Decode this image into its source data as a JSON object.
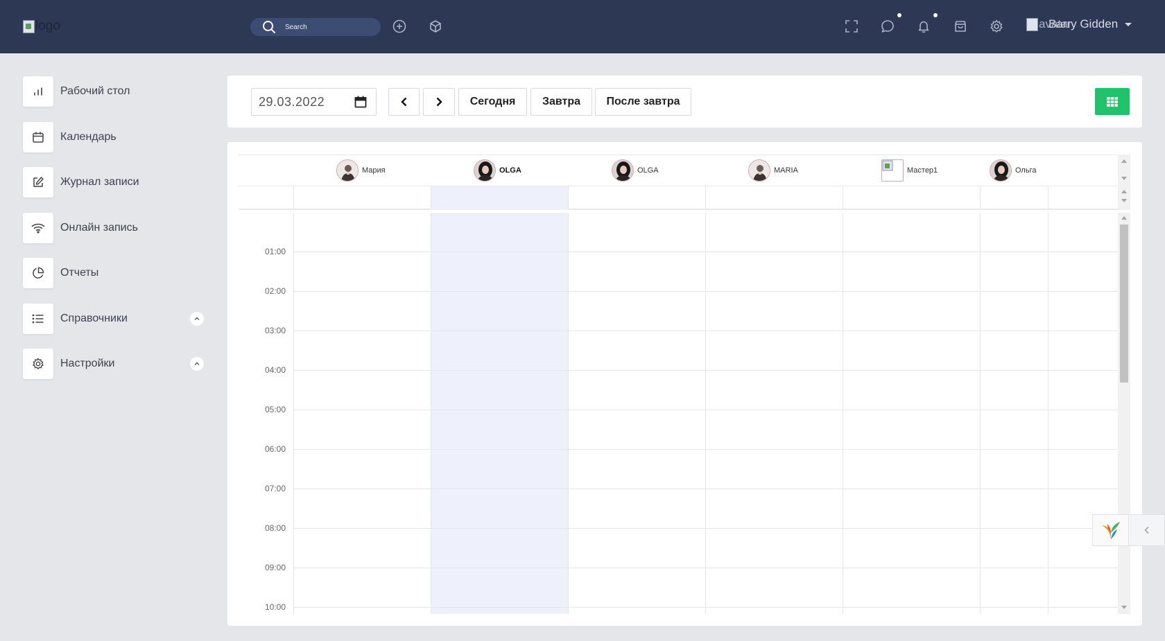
{
  "header": {
    "logo_alt": "logo",
    "search_placeholder": "Search",
    "user": {
      "avatar_alt": "avatar",
      "name": "Barry Gidden"
    }
  },
  "sidebar": {
    "items": [
      {
        "label": "Рабочий стол",
        "icon": "bar-chart-icon"
      },
      {
        "label": "Календарь",
        "icon": "calendar-icon"
      },
      {
        "label": "Журнал записи",
        "icon": "edit-icon"
      },
      {
        "label": "Онлайн запись",
        "icon": "wifi-icon"
      },
      {
        "label": "Отчеты",
        "icon": "pie-chart-icon"
      },
      {
        "label": "Справочники",
        "icon": "list-icon",
        "expandable": true
      },
      {
        "label": "Настройки",
        "icon": "gear-icon",
        "expandable": true
      }
    ]
  },
  "toolbar": {
    "date": "29.03.2022",
    "today": "Сегодня",
    "tomorrow": "Завтра",
    "after_tomorrow": "После завтра"
  },
  "schedule": {
    "masters": [
      {
        "name": "Мария",
        "bold": false,
        "image": true
      },
      {
        "name": "OLGA",
        "bold": true,
        "image": true
      },
      {
        "name": "OLGA",
        "bold": false,
        "image": true
      },
      {
        "name": "MARIA",
        "bold": false,
        "image": true
      },
      {
        "name": "Мастер1",
        "bold": false,
        "image": false
      },
      {
        "name": "Ольга",
        "bold": false,
        "image": true
      }
    ],
    "times": [
      "01:00",
      "02:00",
      "03:00",
      "04:00",
      "05:00",
      "06:00",
      "07:00",
      "08:00",
      "09:00",
      "10:00"
    ]
  },
  "colors": {
    "topbar": "#2d3855",
    "accent_green": "#21c36a",
    "highlight_column": "#eef0fb"
  }
}
